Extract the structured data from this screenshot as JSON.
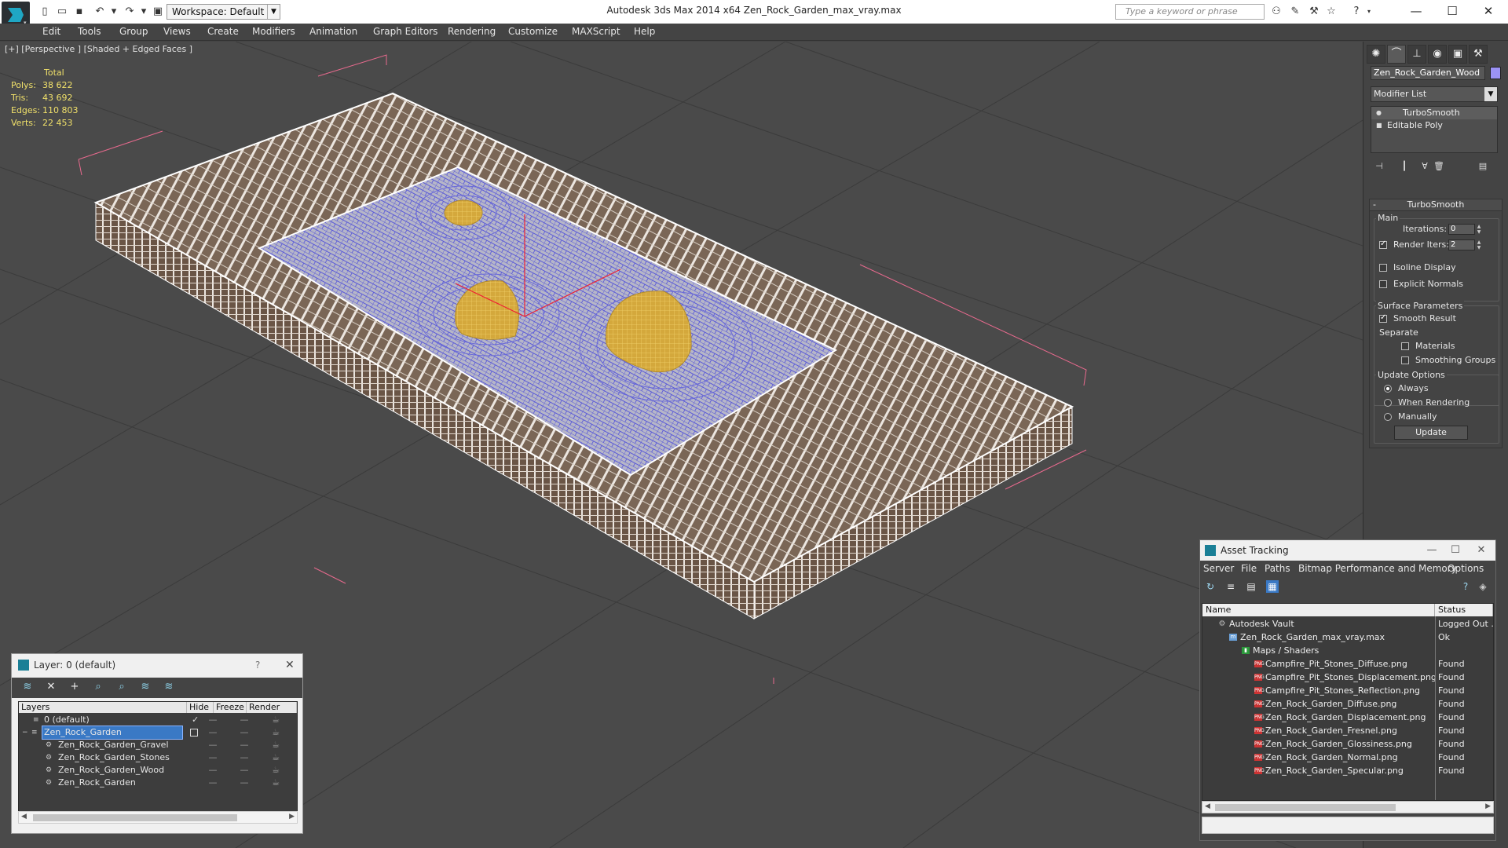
{
  "titlebar": {
    "workspace": "Workspace: Default",
    "app_title": "Autodesk 3ds Max  2014 x64      Zen_Rock_Garden_max_vray.max",
    "search_placeholder": "Type a keyword or phrase"
  },
  "menu": [
    "Edit",
    "Tools",
    "Group",
    "Views",
    "Create",
    "Modifiers",
    "Animation",
    "Graph Editors",
    "Rendering",
    "Customize",
    "MAXScript",
    "Help"
  ],
  "viewport": {
    "label": "[+] [Perspective ] [Shaded + Edged Faces ]",
    "stats": {
      "header": "Total",
      "polys_label": "Polys:",
      "polys": "38 622",
      "tris_label": "Tris:",
      "tris": "43 692",
      "edges_label": "Edges:",
      "edges": "110 803",
      "verts_label": "Verts:",
      "verts": "22 453"
    }
  },
  "command_panel": {
    "object_name": "Zen_Rock_Garden_Wood",
    "object_color": "#9b92f5",
    "modifier_list": "Modifier List",
    "stack": [
      "TurboSmooth",
      "Editable Poly"
    ],
    "turbosmooth": {
      "title": "TurboSmooth",
      "main": "Main",
      "iterations_label": "Iterations:",
      "iterations": "0",
      "render_iters_label": "Render Iters:",
      "render_iters": "2",
      "isoline": "Isoline Display",
      "explicit_normals": "Explicit Normals",
      "surface_params": "Surface Parameters",
      "smooth_result": "Smooth Result",
      "separate": "Separate",
      "materials": "Materials",
      "smoothing_groups": "Smoothing Groups",
      "update_options": "Update Options",
      "always": "Always",
      "when_rendering": "When Rendering",
      "manually": "Manually",
      "update": "Update"
    }
  },
  "layer_dialog": {
    "title": "Layer: 0 (default)",
    "help": "?",
    "columns": [
      "Layers",
      "Hide",
      "Freeze",
      "Render"
    ],
    "rows": [
      "0 (default)",
      "Zen_Rock_Garden",
      "Zen_Rock_Garden_Gravel",
      "Zen_Rock_Garden_Stones",
      "Zen_Rock_Garden_Wood",
      "Zen_Rock_Garden"
    ]
  },
  "asset_dialog": {
    "title": "Asset Tracking",
    "menu": [
      "Server",
      "File",
      "Paths",
      "Bitmap Performance and Memory",
      "Options"
    ],
    "columns": [
      "Name",
      "Status"
    ],
    "rows": [
      {
        "name": "Autodesk Vault",
        "status": "Logged Out ."
      },
      {
        "name": "Zen_Rock_Garden_max_vray.max",
        "status": "Ok"
      },
      {
        "name": "Maps / Shaders",
        "status": ""
      },
      {
        "name": "Campfire_Pit_Stones_Diffuse.png",
        "status": "Found"
      },
      {
        "name": "Campfire_Pit_Stones_Displacement.png",
        "status": "Found"
      },
      {
        "name": "Campfire_Pit_Stones_Reflection.png",
        "status": "Found"
      },
      {
        "name": "Zen_Rock_Garden_Diffuse.png",
        "status": "Found"
      },
      {
        "name": "Zen_Rock_Garden_Displacement.png",
        "status": "Found"
      },
      {
        "name": "Zen_Rock_Garden_Fresnel.png",
        "status": "Found"
      },
      {
        "name": "Zen_Rock_Garden_Glossiness.png",
        "status": "Found"
      },
      {
        "name": "Zen_Rock_Garden_Normal.png",
        "status": "Found"
      },
      {
        "name": "Zen_Rock_Garden_Specular.png",
        "status": "Found"
      }
    ]
  }
}
